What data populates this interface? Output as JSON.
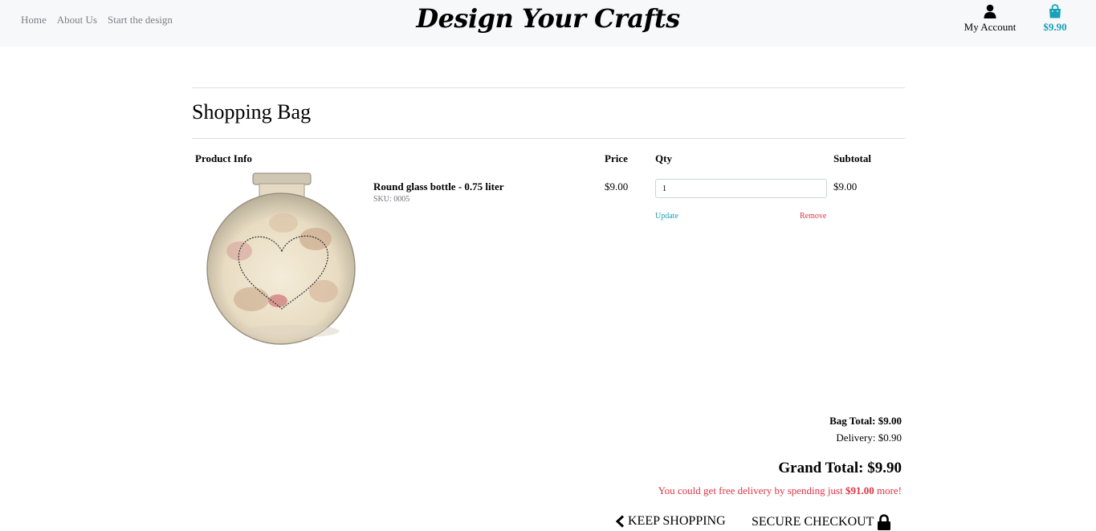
{
  "nav": {
    "home": "Home",
    "about": "About Us",
    "start": "Start the design"
  },
  "brand": "Design Your Crafts",
  "account": {
    "label": "My Account",
    "icon": "user-icon"
  },
  "bag": {
    "total": "$9.90",
    "icon": "shopping-bag-icon",
    "color": "#17a2b8"
  },
  "page_title": "Shopping Bag",
  "columns": {
    "product": "Product Info",
    "price": "Price",
    "qty": "Qty",
    "subtotal": "Subtotal"
  },
  "items": [
    {
      "name": "Round glass bottle - 0.75 liter",
      "sku": "SKU: 0005",
      "price": "$9.00",
      "qty": "1",
      "subtotal": "$9.00",
      "update": "Update",
      "remove": "Remove"
    }
  ],
  "summary": {
    "bag_total": "Bag Total: $9.00",
    "delivery": "Delivery: $0.90",
    "grand_total": "Grand Total: $9.90",
    "free_delivery_prefix": "You could get free delivery by spending just ",
    "free_delivery_amount": "$91.00",
    "free_delivery_suffix": " more!"
  },
  "buttons": {
    "keep_shopping": "KEEP SHOPPING",
    "checkout": "SECURE CHECKOUT"
  },
  "colors": {
    "accent": "#17a2b8",
    "danger": "#dc3545",
    "header_bg": "#f7f8f9"
  }
}
